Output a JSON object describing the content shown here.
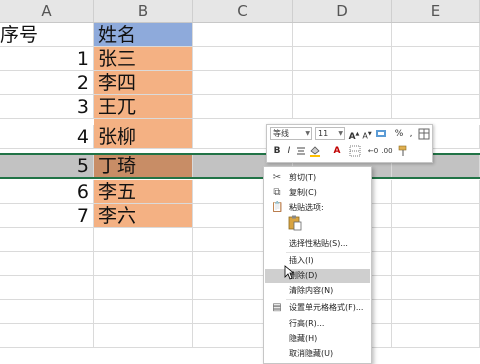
{
  "columns": [
    "A",
    "B",
    "C",
    "D",
    "E"
  ],
  "rows": [
    {
      "a": "序号",
      "b": "姓名"
    },
    {
      "a": "1",
      "b": "张三"
    },
    {
      "a": "2",
      "b": "李四"
    },
    {
      "a": "3",
      "b": "王兀"
    },
    {
      "a": "4",
      "b": "张柳"
    },
    {
      "a": "5",
      "b": "丁琦"
    },
    {
      "a": "6",
      "b": "李五"
    },
    {
      "a": "7",
      "b": "李六"
    }
  ],
  "mini_toolbar": {
    "font": "等线",
    "size": "11",
    "percent": "%",
    "bold": "B",
    "italic": "I",
    "font_grow": "A",
    "font_shrink": "A"
  },
  "context_menu": {
    "cut": "剪切(T)",
    "copy": "复制(C)",
    "paste_options": "粘贴选项:",
    "paste_special": "选择性粘贴(S)...",
    "insert": "插入(I)",
    "delete": "删除(D)",
    "clear": "清除内容(N)",
    "format_cells": "设置单元格格式(F)...",
    "row_height": "行高(R)...",
    "hide": "隐藏(H)",
    "unhide": "取消隐藏(U)"
  },
  "colors": {
    "header_fill": "#8eaadb",
    "name_fill": "#f4b183",
    "selection_border": "#217346"
  }
}
